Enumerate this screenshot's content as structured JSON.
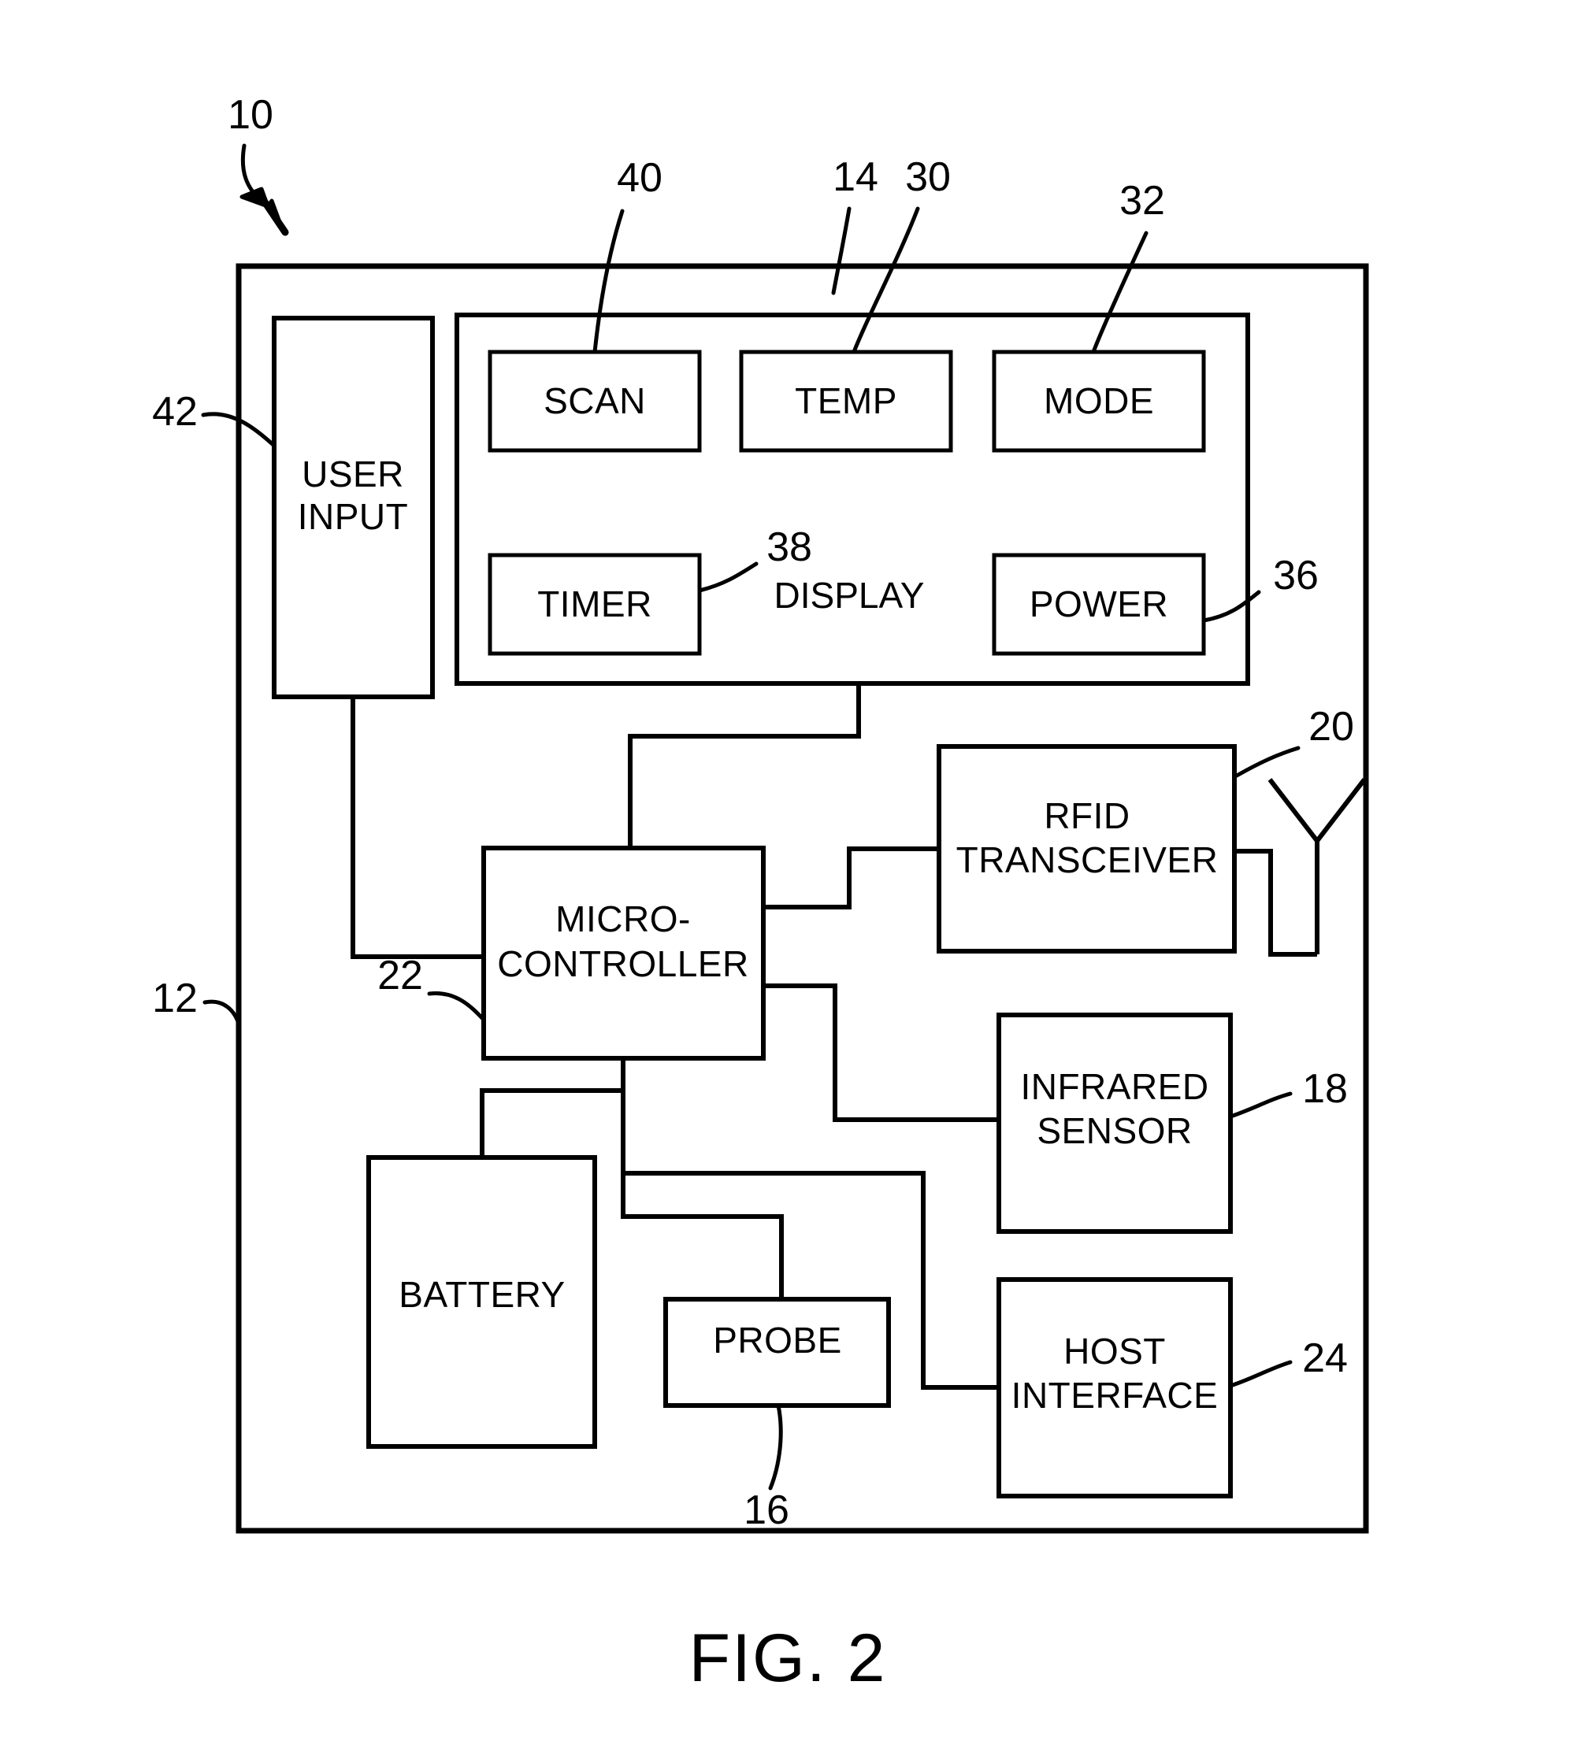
{
  "figure": {
    "caption": "FIG. 2",
    "device_ref": "10"
  },
  "enclosure": {
    "name": "device-housing",
    "ref": "12"
  },
  "display_panel": {
    "name": "display",
    "label": "DISPLAY",
    "ref": "38",
    "panel_ref": "14"
  },
  "buttons": [
    {
      "label": "SCAN",
      "ref": "40"
    },
    {
      "label": "TEMP",
      "ref": "30"
    },
    {
      "label": "MODE",
      "ref": "32"
    },
    {
      "label": "TIMER",
      "ref": "38"
    },
    {
      "label": "POWER",
      "ref": "36"
    }
  ],
  "blocks": {
    "user_input": {
      "label_line1": "USER",
      "label_line2": "INPUT",
      "ref": "42"
    },
    "microcontroller": {
      "label_line1": "MICRO-",
      "label_line2": "CONTROLLER",
      "ref": "22"
    },
    "rfid": {
      "label_line1": "RFID",
      "label_line2": "TRANSCEIVER",
      "ref": "20"
    },
    "infrared": {
      "label_line1": "INFRARED",
      "label_line2": "SENSOR",
      "ref": "18"
    },
    "battery": {
      "label_line1": "BATTERY",
      "label_line2": "",
      "ref": ""
    },
    "probe": {
      "label_line1": "PROBE",
      "label_line2": "",
      "ref": "16"
    },
    "host": {
      "label_line1": "HOST",
      "label_line2": "INTERFACE",
      "ref": "24"
    }
  },
  "refs": {
    "r10": "10",
    "r12": "12",
    "r14": "14",
    "r16": "16",
    "r18": "18",
    "r20": "20",
    "r22": "22",
    "r24": "24",
    "r30": "30",
    "r32": "32",
    "r36": "36",
    "r38": "38",
    "r40": "40",
    "r42": "42"
  },
  "icons": {
    "antenna": "antenna-icon",
    "leader_arrow": "leader-arrow-icon"
  },
  "colors": {
    "ink": "#000000",
    "paper": "#ffffff"
  }
}
